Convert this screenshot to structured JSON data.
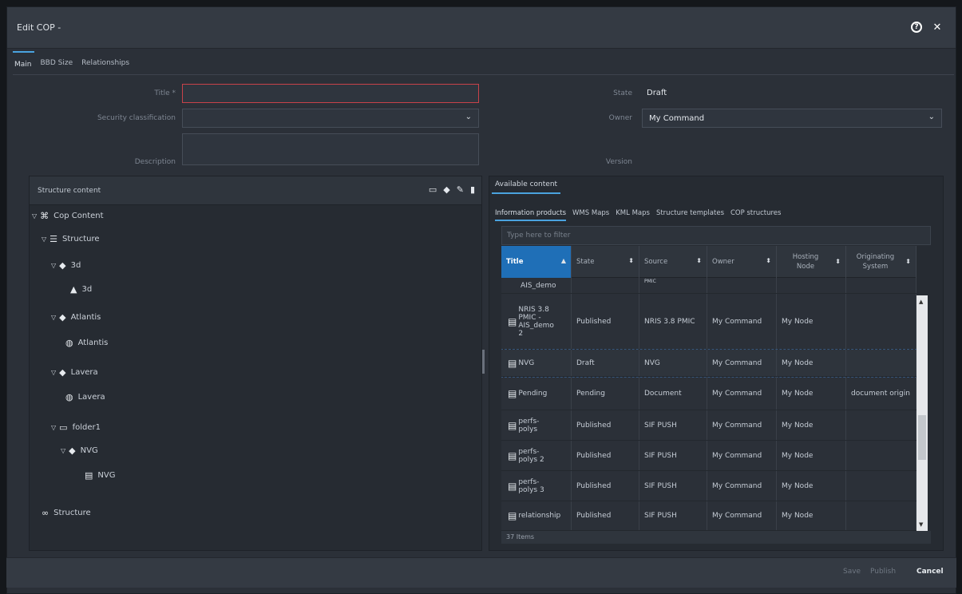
{
  "dialog": {
    "title": "Edit COP -",
    "help_icon": "question-circle-icon",
    "close_icon": "close-icon"
  },
  "tabs": [
    {
      "label": "Main",
      "active": true
    },
    {
      "label": "BBD Size",
      "active": false
    },
    {
      "label": "Relationships",
      "active": false
    }
  ],
  "form": {
    "title_label": "Title *",
    "title_value": "",
    "security_label": "Security classification",
    "security_value": "",
    "description_label": "Description",
    "description_value": "",
    "state_label": "State",
    "state_value": "Draft",
    "owner_label": "Owner",
    "owner_value": "My Command",
    "version_label": "Version"
  },
  "structure_panel": {
    "title": "Structure content",
    "tools": [
      "folder-icon",
      "diamond-icon",
      "pencil-icon",
      "trash-icon"
    ],
    "tree": [
      {
        "label": "Cop Content",
        "level": 0,
        "icon": "cop-icon",
        "expanded": true
      },
      {
        "label": "Structure",
        "level": 1,
        "icon": "structure-icon",
        "expanded": true
      },
      {
        "label": "3d",
        "level": 2,
        "icon": "diamond-icon",
        "expanded": true
      },
      {
        "label": "3d",
        "level": 3,
        "icon": "shapes-icon"
      },
      {
        "label": "Atlantis",
        "level": 2,
        "icon": "diamond-icon",
        "expanded": true
      },
      {
        "label": "Atlantis",
        "level": 3,
        "icon": "globe-icon"
      },
      {
        "label": "Lavera",
        "level": 2,
        "icon": "diamond-icon",
        "expanded": true
      },
      {
        "label": "Lavera",
        "level": 3,
        "icon": "globe-icon"
      },
      {
        "label": "folder1",
        "level": 2,
        "icon": "folder-icon",
        "expanded": true
      },
      {
        "label": "NVG",
        "level": 3,
        "icon": "diamond-icon",
        "expanded": true
      },
      {
        "label": "NVG",
        "level": 4,
        "icon": "document-icon"
      },
      {
        "label": "Structure",
        "level": 1,
        "icon": "link-icon"
      }
    ]
  },
  "available": {
    "tab": "Available content",
    "subtabs": [
      {
        "label": "Information products",
        "active": true
      },
      {
        "label": "WMS Maps",
        "active": false
      },
      {
        "label": "KML Maps",
        "active": false
      },
      {
        "label": "Structure templates",
        "active": false
      },
      {
        "label": "COP structures",
        "active": false
      }
    ],
    "filter_placeholder": "Type here to filter",
    "columns": [
      {
        "label": "Title",
        "sort": "▲"
      },
      {
        "label": "State",
        "sort": "⬍"
      },
      {
        "label": "Source",
        "sort": "⬍"
      },
      {
        "label": "Owner",
        "sort": "⬍"
      },
      {
        "label": "Hosting\nNode",
        "sort": "⬍"
      },
      {
        "label": "Originating\nSystem",
        "sort": "⬍"
      }
    ],
    "rows": [
      {
        "title": "AIS_demo",
        "state": "",
        "source": "PMIC",
        "owner": "",
        "node": "",
        "origin": ""
      },
      {
        "title": "NRIS 3.8 PMIC - AIS_demo 2",
        "state": "Published",
        "source": "NRIS 3.8 PMIC",
        "owner": "My Command",
        "node": "My Node",
        "origin": ""
      },
      {
        "title": "NVG",
        "state": "Draft",
        "source": "NVG",
        "owner": "My Command",
        "node": "My Node",
        "origin": ""
      },
      {
        "title": "Pending",
        "state": "Pending",
        "source": "Document",
        "owner": "My Command",
        "node": "My Node",
        "origin": "document origin"
      },
      {
        "title": "perfs-polys",
        "state": "Published",
        "source": "SIF PUSH",
        "owner": "My Command",
        "node": "My Node",
        "origin": ""
      },
      {
        "title": "perfs-polys 2",
        "state": "Published",
        "source": "SIF PUSH",
        "owner": "My Command",
        "node": "My Node",
        "origin": ""
      },
      {
        "title": "perfs-polys 3",
        "state": "Published",
        "source": "SIF PUSH",
        "owner": "My Command",
        "node": "My Node",
        "origin": ""
      },
      {
        "title": "relationship",
        "state": "Published",
        "source": "SIF PUSH",
        "owner": "My Command",
        "node": "My Node",
        "origin": ""
      }
    ],
    "item_count": "37 Items"
  },
  "footer": {
    "save": "Save",
    "publish": "Publish",
    "cancel": "Cancel"
  }
}
